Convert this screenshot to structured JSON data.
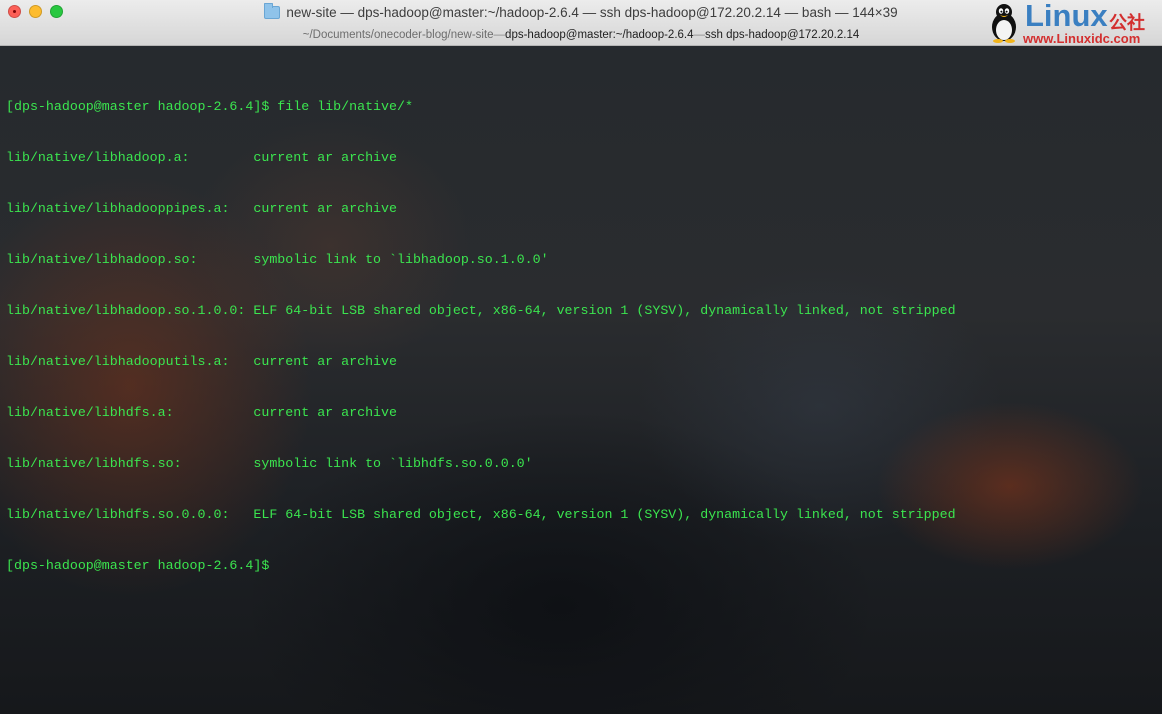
{
  "window": {
    "title": "new-site — dps-hadoop@master:~/hadoop-2.6.4 — ssh dps-hadoop@172.20.2.14 — bash — 144×39",
    "tab_path": "~/Documents/onecoder-blog/new-site",
    "tab_sep_1": " — ",
    "tab_active": "dps-hadoop@master:~/hadoop-2.6.4",
    "tab_sep_2": " — ",
    "tab_ssh": "ssh dps-hadoop@172.20.2.14"
  },
  "watermark": {
    "word": "Linux",
    "cn": "公社",
    "url": "www.Linuxidc.com"
  },
  "terminal": {
    "text_color": "#3be54f",
    "lines": [
      "[dps-hadoop@master hadoop-2.6.4]$ file lib/native/*",
      "lib/native/libhadoop.a:        current ar archive",
      "lib/native/libhadooppipes.a:   current ar archive",
      "lib/native/libhadoop.so:       symbolic link to `libhadoop.so.1.0.0'",
      "lib/native/libhadoop.so.1.0.0: ELF 64-bit LSB shared object, x86-64, version 1 (SYSV), dynamically linked, not stripped",
      "lib/native/libhadooputils.a:   current ar archive",
      "lib/native/libhdfs.a:          current ar archive",
      "lib/native/libhdfs.so:         symbolic link to `libhdfs.so.0.0.0'",
      "lib/native/libhdfs.so.0.0.0:   ELF 64-bit LSB shared object, x86-64, version 1 (SYSV), dynamically linked, not stripped",
      "[dps-hadoop@master hadoop-2.6.4]$ "
    ]
  }
}
